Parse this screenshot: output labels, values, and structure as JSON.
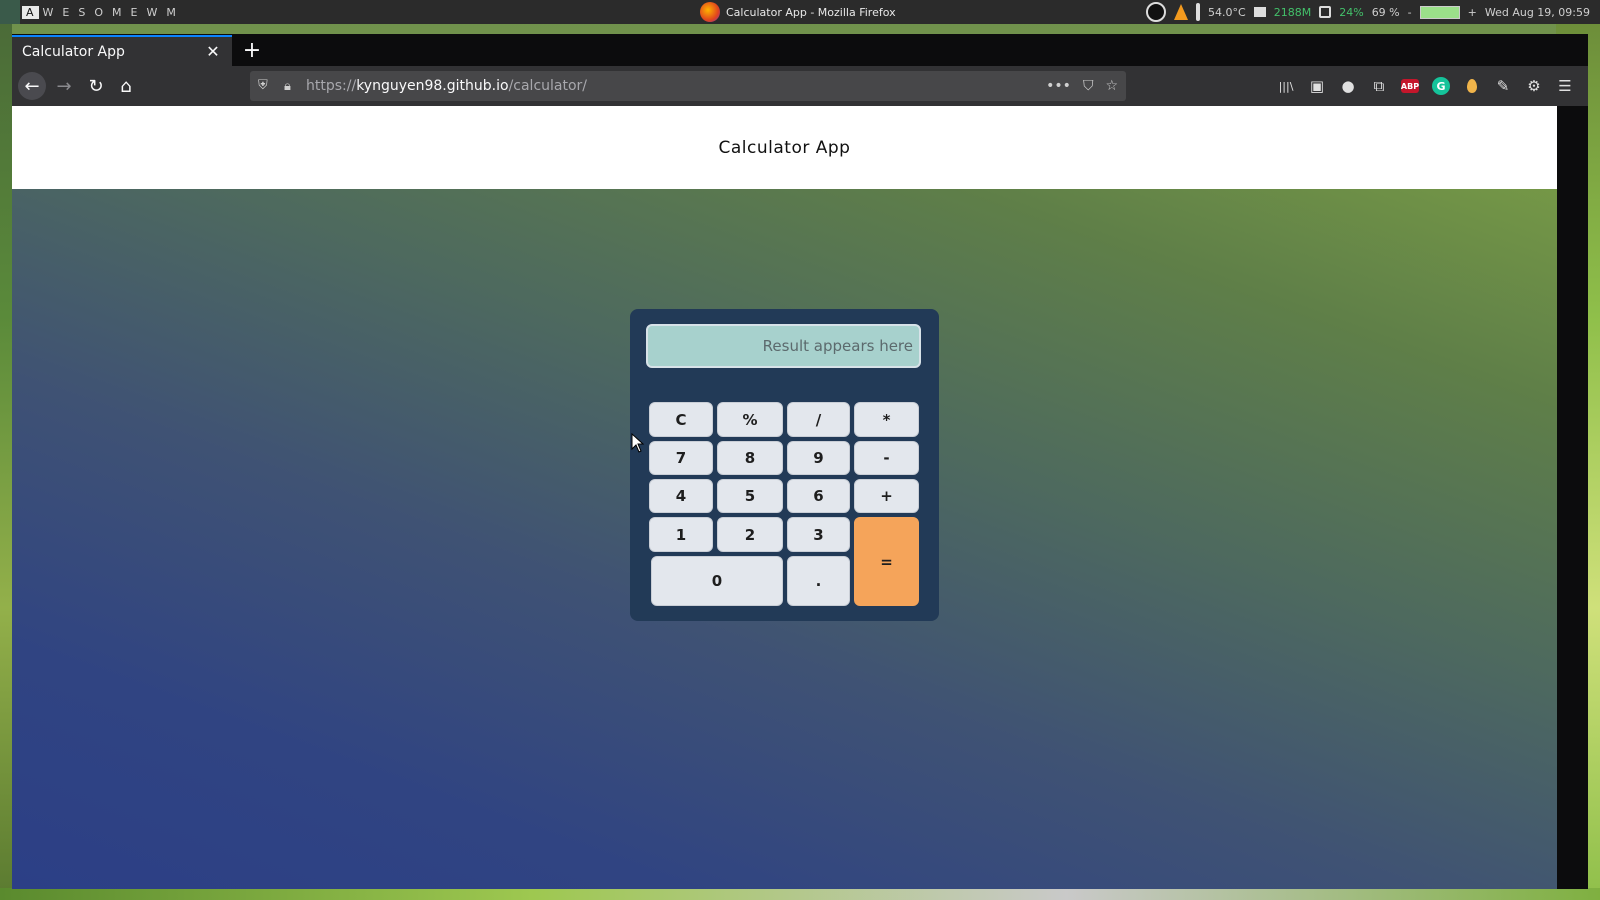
{
  "wm": {
    "tags": [
      "A",
      "W",
      "E",
      "S",
      "O",
      "M",
      "E",
      "W",
      "M"
    ],
    "window_title": "Calculator App - Mozilla Firefox",
    "temperature": "54.0°C",
    "memory": "2188M",
    "brightness": "24%",
    "battery_percent": "69 %",
    "battery_separator": "-",
    "battery_plus": "+",
    "datetime": "Wed Aug 19, 09:59",
    "icons": [
      "obs-icon",
      "vlc-icon",
      "thermometer-icon",
      "memory-icon",
      "brightness-icon",
      "battery-icon"
    ]
  },
  "browser": {
    "tab_title": "Calculator App",
    "tab_close_symbol": "✕",
    "new_tab_symbol": "+",
    "back_symbol": "←",
    "forward_symbol": "→",
    "reload_symbol": "↻",
    "home_symbol": "⌂",
    "url_scheme": "https://",
    "url_host": "kynguyen98.github.io",
    "url_path": "/calculator/",
    "url_more_symbol": "•••",
    "url_pocket_symbol": "⛉",
    "url_star_symbol": "☆",
    "toolbar": {
      "library_symbol": "|||\\",
      "sidebar_symbol": "▣",
      "account_symbol": "●",
      "pip_symbol": "⧉",
      "abp_label": "ABP",
      "grammarly_label": "G",
      "pen_symbol": "✎",
      "settings_symbol": "⚙",
      "menu_symbol": "☰"
    }
  },
  "page": {
    "title": "Calculator App"
  },
  "calculator": {
    "display_placeholder": "Result appears here",
    "keys": {
      "clear": "C",
      "percent": "%",
      "divide": "/",
      "multiply": "*",
      "seven": "7",
      "eight": "8",
      "nine": "9",
      "minus": "-",
      "four": "4",
      "five": "5",
      "six": "6",
      "plus": "+",
      "one": "1",
      "two": "2",
      "three": "3",
      "equals": "=",
      "zero": "0",
      "decimal": "."
    },
    "colors": {
      "body": "#223a57",
      "display": "#a7d1cd",
      "key": "#e3e7ed",
      "equals": "#f5a45a"
    }
  }
}
